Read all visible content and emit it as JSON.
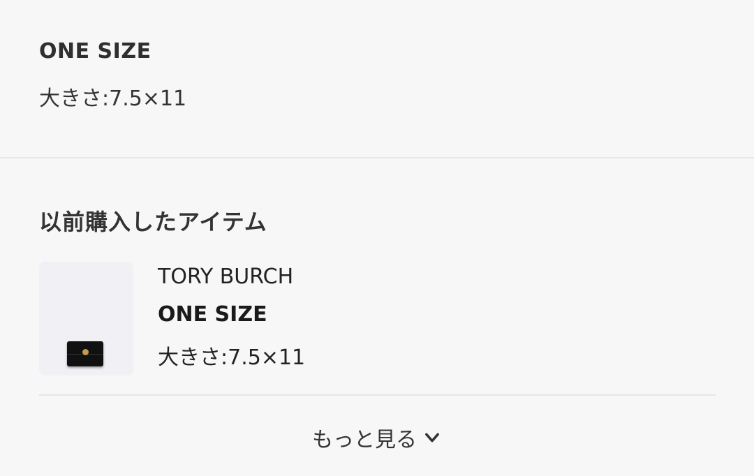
{
  "current_size": {
    "title": "ONE SIZE",
    "dimensions": "大きさ:7.5×11"
  },
  "purchase_history": {
    "heading": "以前購入したアイテム",
    "items": [
      {
        "brand": "TORY BURCH",
        "size": "ONE SIZE",
        "dimensions": "大きさ:7.5×11",
        "image": "black-wallet-thumbnail"
      }
    ],
    "more_label": "もっと見る",
    "more_icon": "chevron-down-icon"
  },
  "colors": {
    "background": "#f7f7f8",
    "text": "#2b2b2b",
    "divider": "#e6e6e8",
    "thumbnail_bg": "#f1f1f5",
    "wallet": "#111111",
    "logo_gold": "#c29b4e"
  }
}
